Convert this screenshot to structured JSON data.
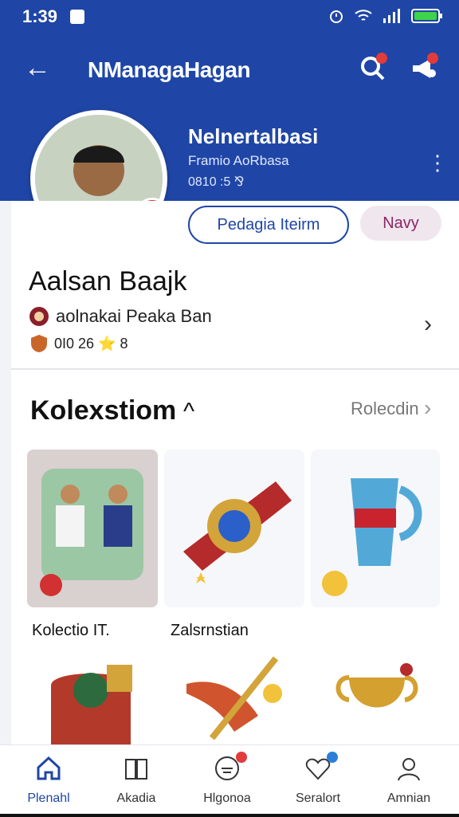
{
  "status": {
    "time": "1:39"
  },
  "header": {
    "title": "NManagaHagan",
    "name": "Nelnertalbasi",
    "subtitle": "Framio AoRbasa",
    "stats": "0810 :5 ⅋"
  },
  "profile": {
    "button_primary": "Pedagia Iteirm",
    "button_secondary": "Navy",
    "name": "Aalsan Baajk",
    "club": "aolnakai Peaka Ban",
    "stats": "0I0 26 ⭐ 8"
  },
  "collection": {
    "title": "Kolexstiom",
    "link": "Rolecdin",
    "items": [
      {
        "label": "Kolectio IT."
      },
      {
        "label": "Zalsrnstian"
      }
    ]
  },
  "nav": [
    {
      "label": "Plenahl"
    },
    {
      "label": "Akadia"
    },
    {
      "label": "Hlgonoa"
    },
    {
      "label": "Seralort"
    },
    {
      "label": "Amnian"
    }
  ],
  "colors": {
    "primary": "#1f46a6",
    "accent": "#d23131"
  }
}
